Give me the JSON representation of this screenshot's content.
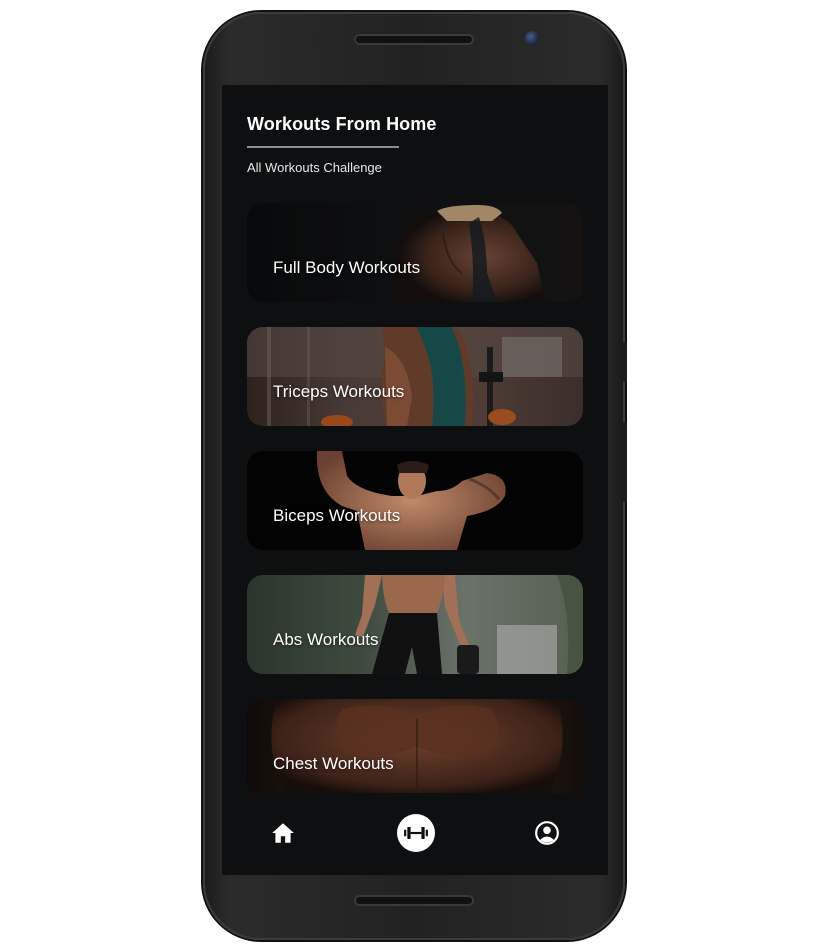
{
  "header": {
    "title": "Workouts From Home",
    "subtitle": "All Workouts Challenge"
  },
  "cards": [
    {
      "label": "Full Body Workouts"
    },
    {
      "label": "Triceps Workouts"
    },
    {
      "label": "Biceps Workouts"
    },
    {
      "label": "Abs Workouts"
    },
    {
      "label": "Chest Workouts"
    }
  ],
  "nav": {
    "items": [
      {
        "icon": "home-icon"
      },
      {
        "icon": "dumbbell-icon",
        "active": true
      },
      {
        "icon": "profile-icon"
      }
    ],
    "active_color": "#ffffff",
    "background": "#0d0f11"
  }
}
